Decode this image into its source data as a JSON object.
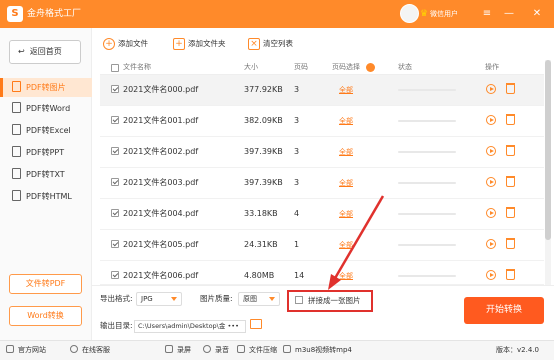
{
  "window": {
    "logo_char": "S",
    "title": "金舟格式工厂",
    "user_name": "微信用户",
    "vip_glyph": "♛",
    "menu_glyph": "≡",
    "min_glyph": "—",
    "close_glyph": "✕"
  },
  "sidebar": {
    "home_label": "返回首页",
    "items": [
      {
        "label": "PDF转图片",
        "active": true
      },
      {
        "label": "PDF转Word"
      },
      {
        "label": "PDF转Excel"
      },
      {
        "label": "PDF转PPT"
      },
      {
        "label": "PDF转TXT"
      },
      {
        "label": "PDF转HTML"
      }
    ],
    "file_to_pdf": "文件转PDF",
    "word_convert": "Word转换"
  },
  "toolbar": {
    "add_file": "添加文件",
    "add_folder": "添加文件夹",
    "clear_list": "清空列表"
  },
  "table": {
    "headers": {
      "name": "文件名称",
      "size": "大小",
      "pages": "页码",
      "page_select": "页码选择",
      "status": "状态",
      "action": "操作"
    },
    "all_label": "全部",
    "rows": [
      {
        "name": "2021文件名000.pdf",
        "size": "377.92KB",
        "pages": "3"
      },
      {
        "name": "2021文件名001.pdf",
        "size": "382.09KB",
        "pages": "3"
      },
      {
        "name": "2021文件名002.pdf",
        "size": "397.39KB",
        "pages": "3"
      },
      {
        "name": "2021文件名003.pdf",
        "size": "397.39KB",
        "pages": "3"
      },
      {
        "name": "2021文件名004.pdf",
        "size": "33.18KB",
        "pages": "4"
      },
      {
        "name": "2021文件名005.pdf",
        "size": "24.31KB",
        "pages": "1"
      },
      {
        "name": "2021文件名006.pdf",
        "size": "4.80MB",
        "pages": "14"
      }
    ]
  },
  "options": {
    "export_format_label": "导出格式:",
    "export_format_value": "JPG",
    "quality_label": "图片质量:",
    "quality_value": "原图",
    "merge_label": "拼接成一张图片",
    "output_label": "输出目录:",
    "output_path": "C:\\Users\\admin\\Desktop\\金",
    "output_more": "•••",
    "start_button": "开始转换"
  },
  "statusbar": {
    "website": "官方网站",
    "consult": "在线客服",
    "record": "录屏",
    "audio": "录音",
    "file_convert": "文件压缩",
    "m3u8": "m3u8视频转mp4",
    "version": "版本：v2.4.0"
  },
  "colors": {
    "accent": "#ff8a2a",
    "start": "#ff5a1f",
    "highlight_border": "#e0312d"
  }
}
